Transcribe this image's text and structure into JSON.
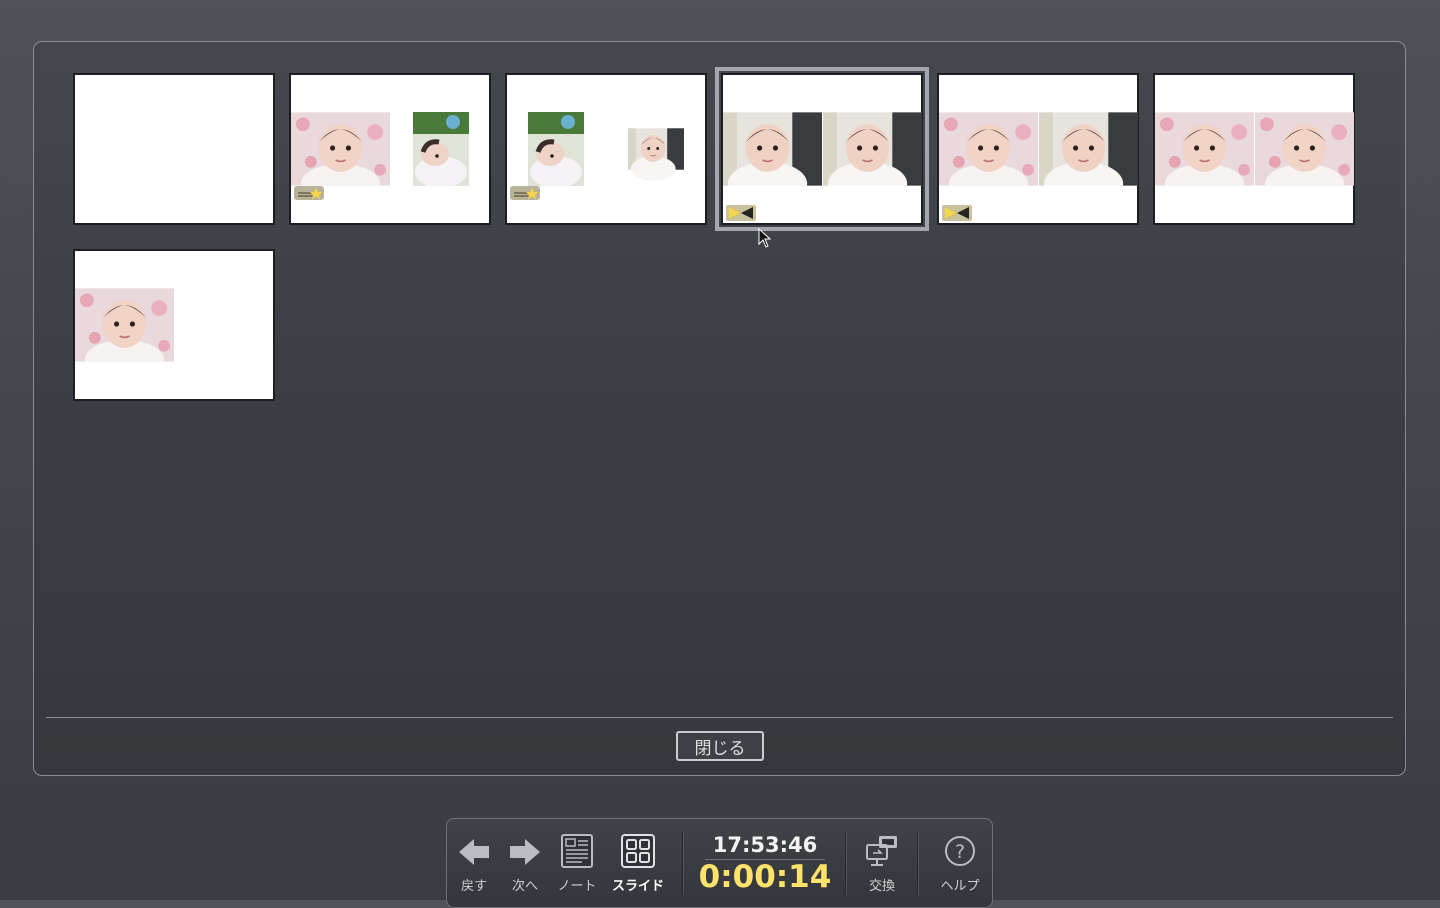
{
  "panel": {
    "close_label": "閉じる",
    "slides": [
      {
        "index": 1,
        "photos": 0,
        "badge": "none"
      },
      {
        "index": 2,
        "photos": 2,
        "badge": "ticket-star-icon"
      },
      {
        "index": 3,
        "photos": 2,
        "badge": "ticket-star-icon"
      },
      {
        "index": 4,
        "photos": 2,
        "badge": "transition-icon",
        "selected": true
      },
      {
        "index": 5,
        "photos": 2,
        "badge": "transition-icon"
      },
      {
        "index": 6,
        "photos": 2,
        "badge": "none"
      },
      {
        "index": 7,
        "photos": 1,
        "badge": "none"
      }
    ]
  },
  "toolbar": {
    "back_label": "戻す",
    "next_label": "次へ",
    "note_label": "ノート",
    "slide_label": "スライド",
    "clock": "17:53:46",
    "elapsed": "0:00:14",
    "swap_label": "交換",
    "help_label": "ヘルプ"
  },
  "colors": {
    "background": "#45494e",
    "elapsed_timer": "#ffe36a",
    "selection_outline": "#a3a7ad"
  }
}
